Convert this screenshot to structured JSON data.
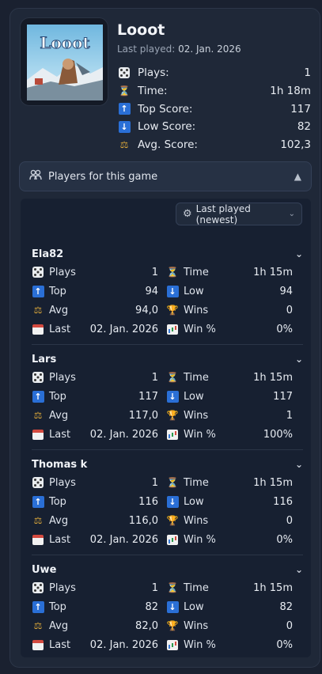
{
  "game": {
    "cover_title": "Looot",
    "title": "Looot",
    "last_played_label": "Last played:",
    "last_played_value": "02. Jan. 2026",
    "stats": [
      {
        "icon": "dice-icon",
        "label": "Plays:",
        "value": "1"
      },
      {
        "icon": "hourglass-icon",
        "label": "Time:",
        "value": "1h 18m"
      },
      {
        "icon": "up-arrow-icon",
        "label": "Top Score:",
        "value": "117"
      },
      {
        "icon": "down-arrow-icon",
        "label": "Low Score:",
        "value": "82"
      },
      {
        "icon": "scale-icon",
        "label": "Avg. Score:",
        "value": "102,3"
      }
    ]
  },
  "players_section": {
    "label": "Players for this game",
    "sort_label": "Last played (newest)"
  },
  "labels": {
    "plays": "Plays",
    "time": "Time",
    "top": "Top",
    "low": "Low",
    "avg": "Avg",
    "wins": "Wins",
    "last": "Last",
    "win_pct": "Win %"
  },
  "players": [
    {
      "name": "Ela82",
      "plays": "1",
      "time": "1h 15m",
      "top": "94",
      "low": "94",
      "avg": "94,0",
      "wins": "0",
      "last": "02. Jan. 2026",
      "win_pct": "0%"
    },
    {
      "name": "Lars",
      "plays": "1",
      "time": "1h 15m",
      "top": "117",
      "low": "117",
      "avg": "117,0",
      "wins": "1",
      "last": "02. Jan. 2026",
      "win_pct": "100%"
    },
    {
      "name": "Thomas k",
      "plays": "1",
      "time": "1h 15m",
      "top": "116",
      "low": "116",
      "avg": "116,0",
      "wins": "0",
      "last": "02. Jan. 2026",
      "win_pct": "0%"
    },
    {
      "name": "Uwe",
      "plays": "1",
      "time": "1h 15m",
      "top": "82",
      "low": "82",
      "avg": "82,0",
      "wins": "0",
      "last": "02. Jan. 2026",
      "win_pct": "0%"
    }
  ]
}
